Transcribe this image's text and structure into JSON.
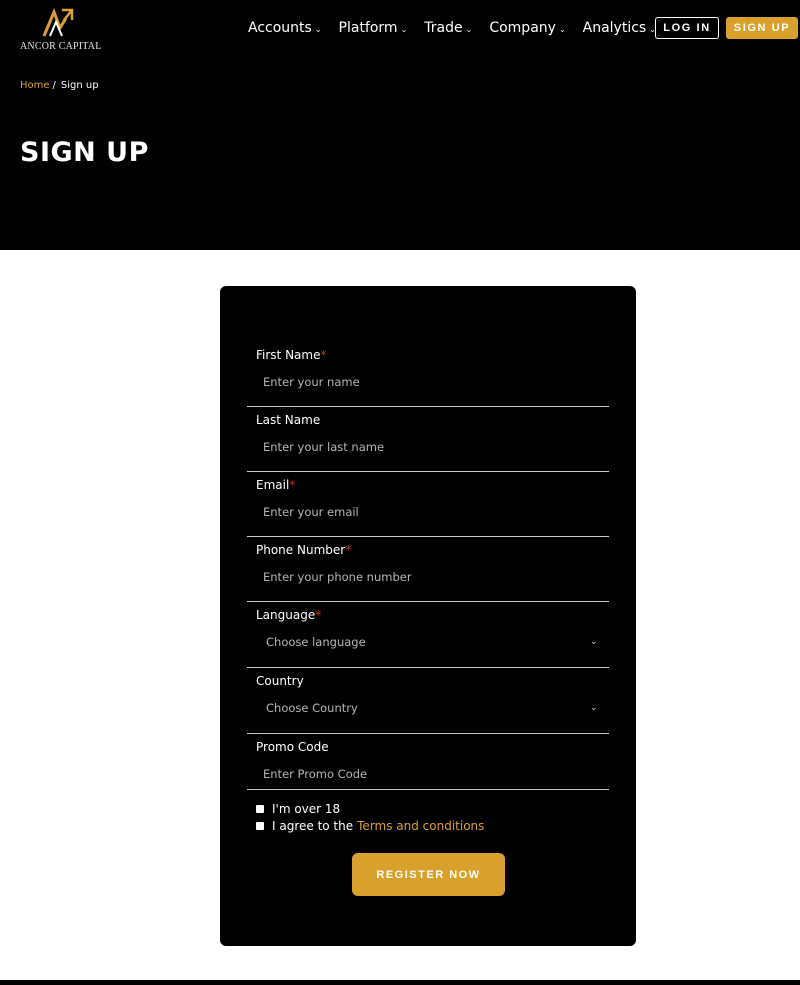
{
  "brand": {
    "name": "ANCOR CAPITAL",
    "accent_color": "#d9a12b"
  },
  "nav": {
    "items": [
      {
        "label": "Accounts"
      },
      {
        "label": "Platform"
      },
      {
        "label": "Trade"
      },
      {
        "label": "Company"
      },
      {
        "label": "Analytics"
      }
    ],
    "login_label": "LOG IN",
    "signup_label": "SIGN UP"
  },
  "breadcrumb": {
    "home": "Home",
    "separator": "/",
    "current": "Sign up"
  },
  "page": {
    "title": "SIGN UP"
  },
  "form": {
    "fields": [
      {
        "label": "First Name",
        "required": "*",
        "placeholder": "Enter your name"
      },
      {
        "label": "Last Name",
        "required": "",
        "placeholder": "Enter your last name"
      },
      {
        "label": "Email",
        "required": "*",
        "placeholder": "Enter your email"
      },
      {
        "label": "Phone Number",
        "required": "*",
        "placeholder": "Enter your phone number"
      },
      {
        "label": "Language",
        "required": "*",
        "selected": "Choose language"
      },
      {
        "label": "Country",
        "required": "",
        "selected": "Choose Country"
      },
      {
        "label": "Promo Code",
        "required": "",
        "placeholder": "Enter Promo Code"
      }
    ],
    "checkboxes": {
      "over18": "I'm over 18",
      "agree_prefix": "I agree to the",
      "terms_link": "Terms and conditions"
    },
    "submit_label": "REGISTER NOW"
  }
}
